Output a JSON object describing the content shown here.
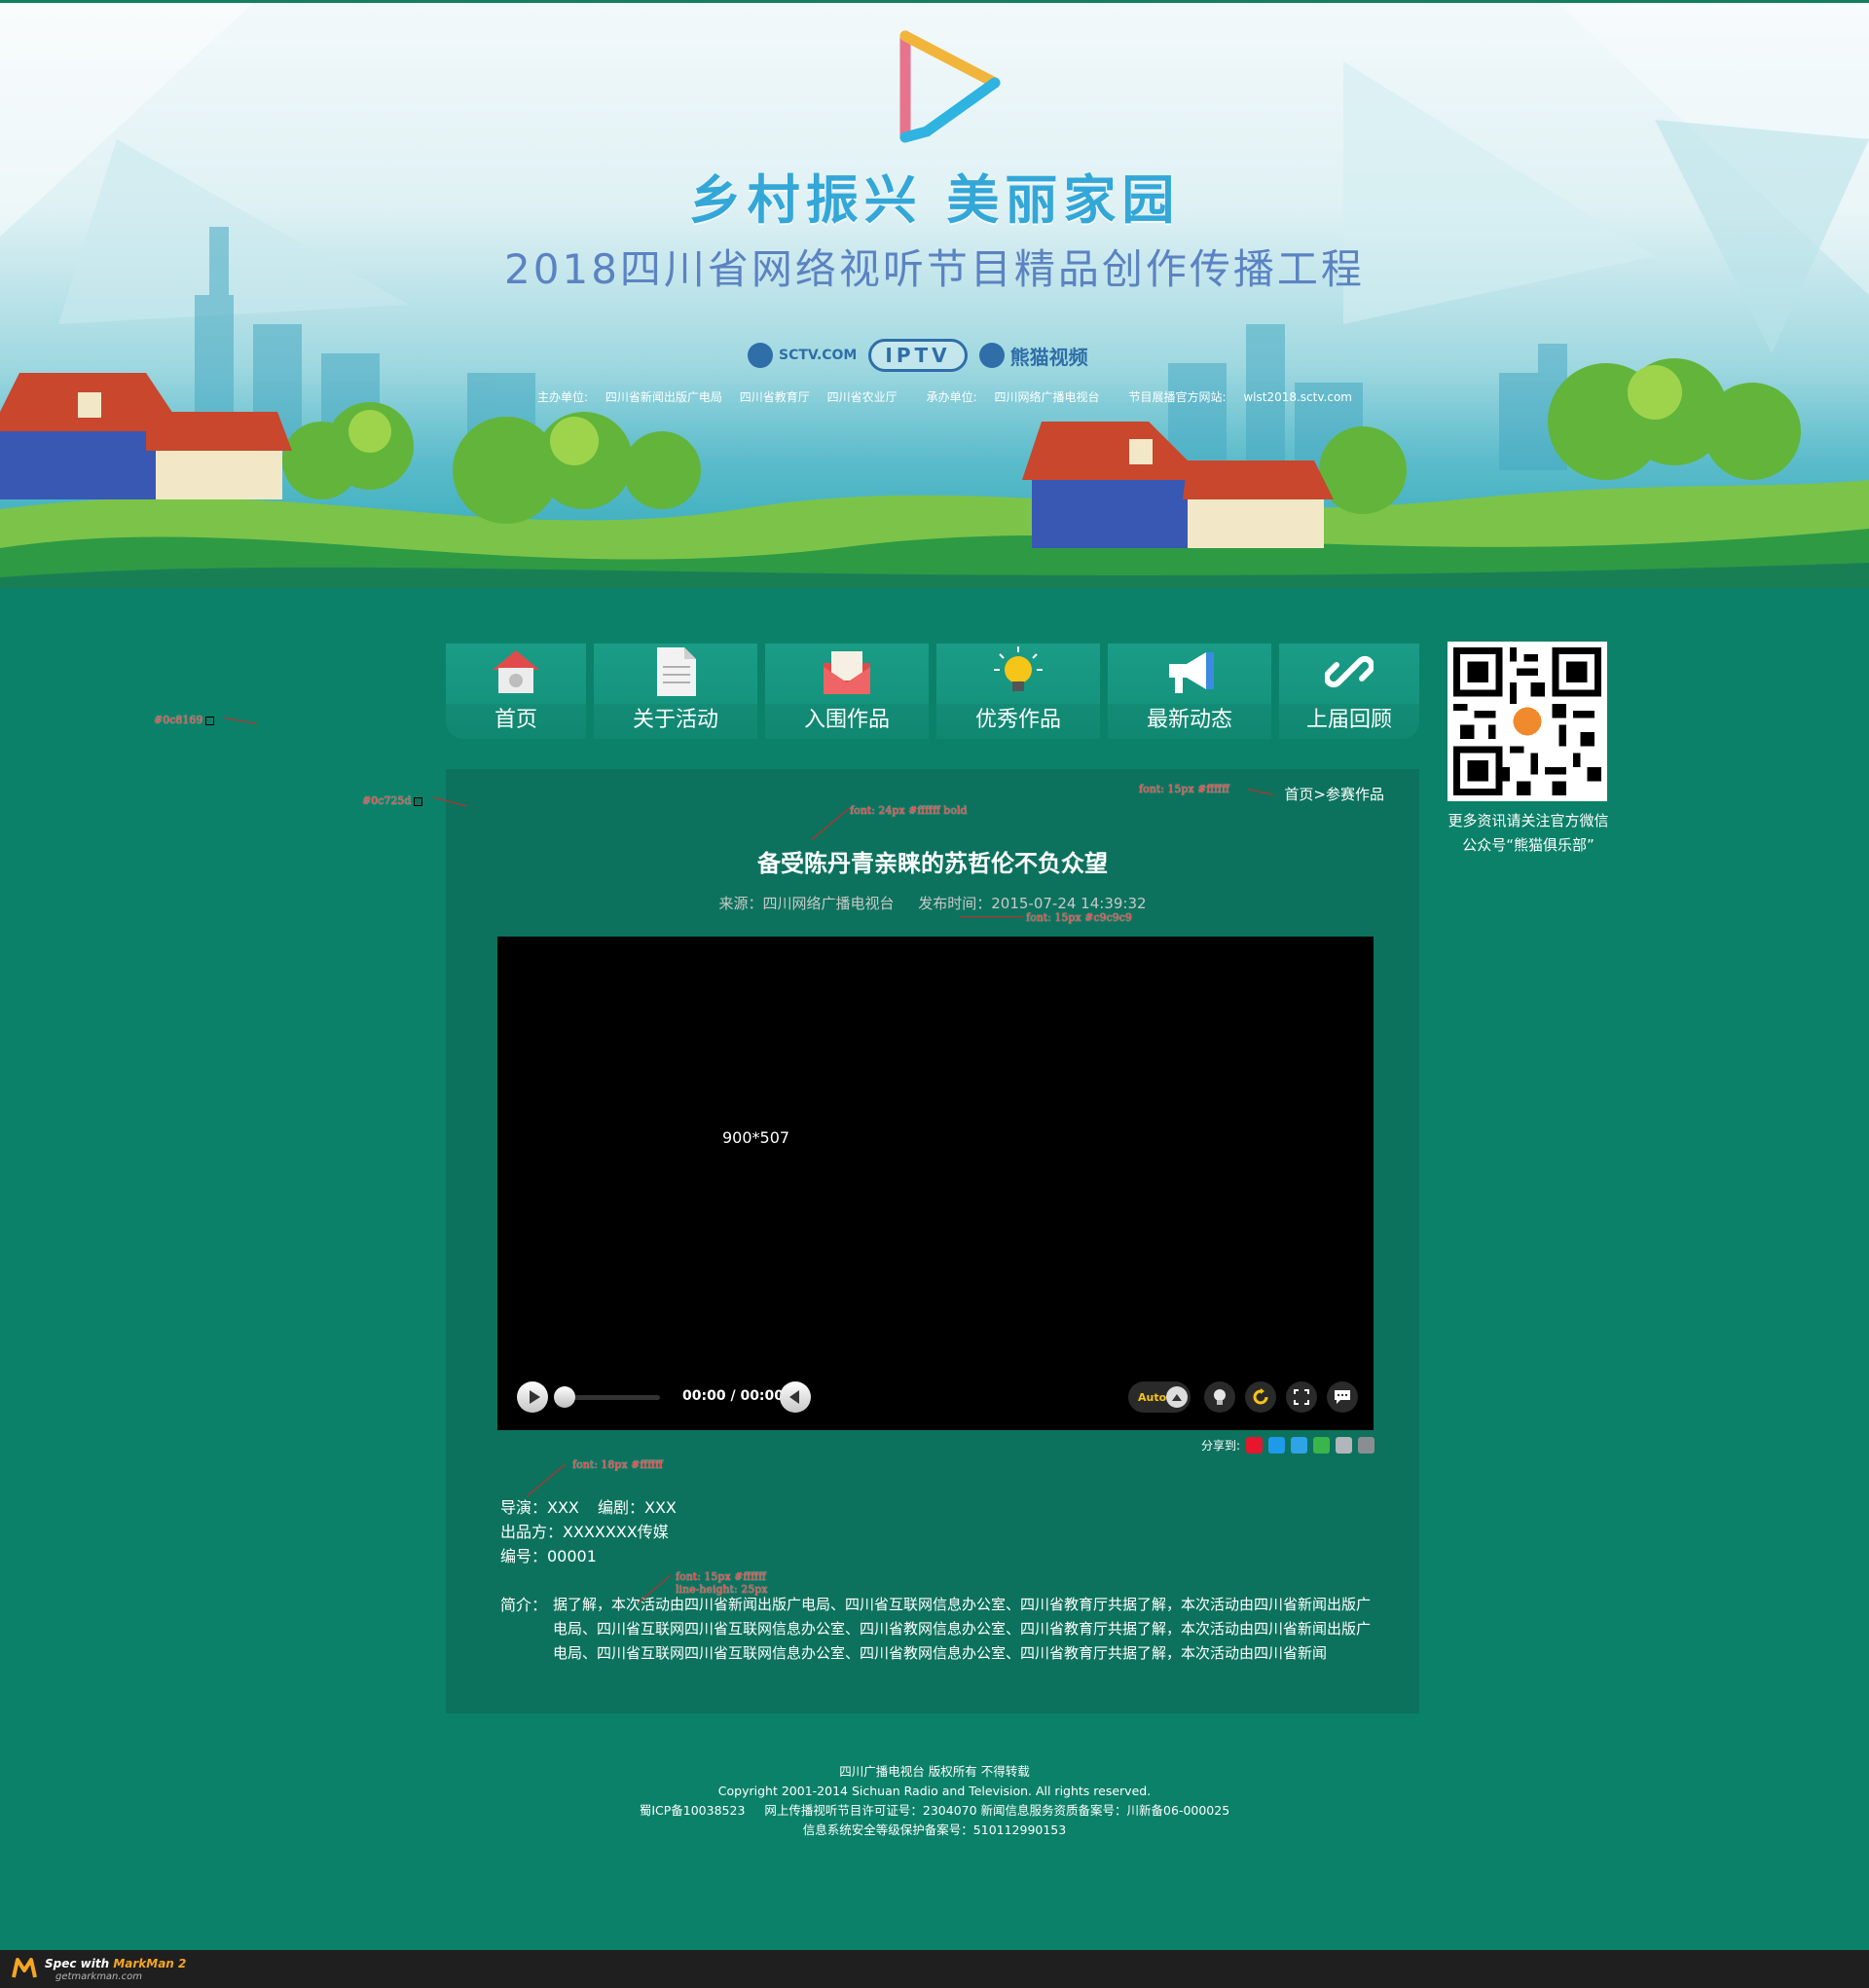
{
  "banner": {
    "title_main": "乡村振兴 美丽家园",
    "title_sub": "2018四川省网络视听节目精品创作传播工程",
    "partners": [
      "SCTV.COM",
      "IPTV",
      "熊猫视频"
    ],
    "organizers": {
      "host_label": "主办单位:",
      "hosts": [
        "四川省新闻出版广电局",
        "四川省教育厅",
        "四川省农业厅"
      ],
      "undertaker_label": "承办单位:",
      "undertaker": "四川网络广播电视台",
      "site_label": "节目展播官方网站:",
      "site": "wlst2018.sctv.com"
    }
  },
  "nav": {
    "items": [
      {
        "label": "首页",
        "icon": "home-icon"
      },
      {
        "label": "关于活动",
        "icon": "document-icon"
      },
      {
        "label": "入围作品",
        "icon": "envelope-icon"
      },
      {
        "label": "优秀作品",
        "icon": "lightbulb-icon"
      },
      {
        "label": "最新动态",
        "icon": "megaphone-icon"
      },
      {
        "label": "上届回顾",
        "icon": "link-icon"
      }
    ]
  },
  "sidebar": {
    "qr_caption_line1": "更多资讯请关注官方微信",
    "qr_caption_line2": "公众号“熊猫俱乐部”"
  },
  "breadcrumb": {
    "home": "首页",
    "sep": ">",
    "current": "参赛作品"
  },
  "article": {
    "title": "备受陈丹青亲睐的苏哲伦不负众望",
    "source": "来源：四川网络广播电视台",
    "published": "发布时间：2015-07-24 14:39:32"
  },
  "player": {
    "size_label": "900*507",
    "time_current": "00:00",
    "time_sep": " / ",
    "time_total": "00:00",
    "quality": "Auto",
    "progress": 0
  },
  "share": {
    "label": "分享到:",
    "targets": [
      "weibo-icon",
      "qq-icon",
      "qzone-icon",
      "wechat-icon",
      "renren-icon",
      "more-share-icon"
    ]
  },
  "credits": {
    "director": "导演：XXX",
    "writer": "编剧：XXX",
    "producer": "出品方：XXXXXXX传媒",
    "number": "编号：00001",
    "intro_label": "简介：",
    "intro_text": "据了解，本次活动由四川省新闻出版广电局、四川省互联网信息办公室、四川省教育厅共据了解，本次活动由四川省新闻出版广电局、四川省互联网四川省互联网信息办公室、四川省教网信息办公室、四川省教育厅共据了解，本次活动由四川省新闻出版广电局、四川省互联网四川省互联网信息办公室、四川省教网信息办公室、四川省教育厅共据了解，本次活动由四川省新闻"
  },
  "footer": {
    "line1": "四川广播电视台 版权所有 不得转载",
    "line2": "Copyright 2001-2014 Sichuan Radio and Television. All rights reserved.",
    "line3a": "蜀ICP备10038523",
    "line3b": "网上传播视听节目许可证号：2304070 新闻信息服务资质备案号：川新备06-000025",
    "line4": "信息系统安全等级保护备案号：510112990153"
  },
  "markman": {
    "prefix": "Spec with ",
    "brand": "MarkMan 2",
    "url": "getmarkman.com"
  },
  "annotations": {
    "bg_color": "#0c8169",
    "panel_color": "#0c725d",
    "breadcrumb_spec": "font: 15px #ffffff",
    "title_spec": "font: 24px #ffffff bold",
    "meta_spec": "font: 15px #c9c9c9",
    "info_spec": "font: 18px #ffffff",
    "intro_spec_1": "font: 15px #ffffff",
    "intro_spec_2": "line-height: 25px"
  },
  "colors": {
    "background": "#0c8169",
    "panel": "#0c725d",
    "nav": "#129079",
    "meta_text": "#c9c9c9"
  }
}
